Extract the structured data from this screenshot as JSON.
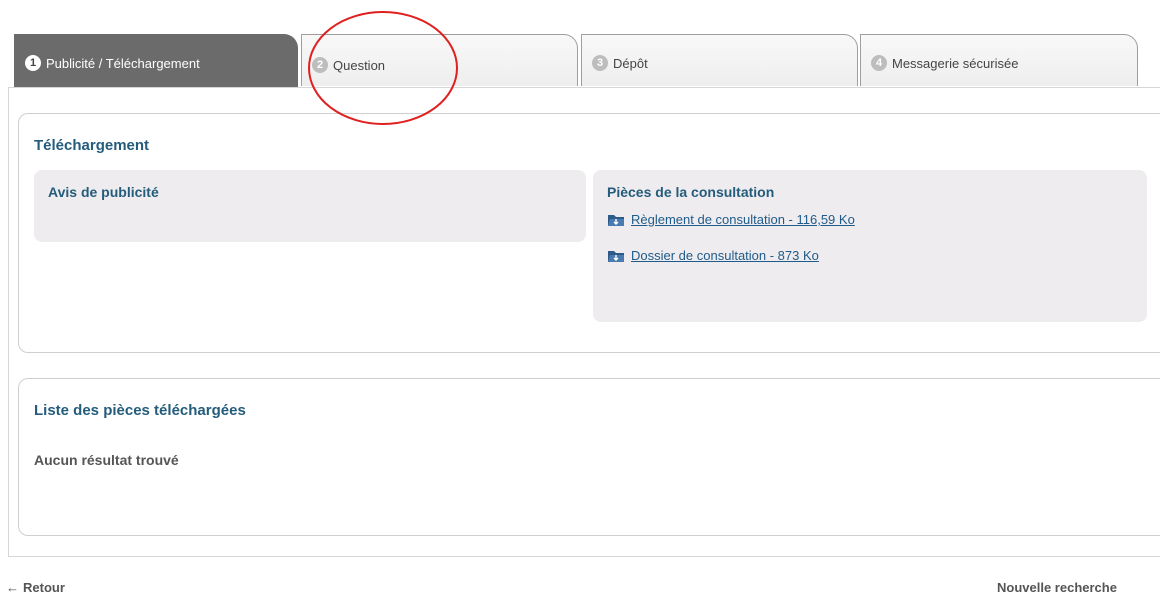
{
  "tabs": [
    {
      "number": "1",
      "label": "Publicité / Téléchargement",
      "active": true
    },
    {
      "number": "2",
      "label": "Question",
      "active": false
    },
    {
      "number": "3",
      "label": "Dépôt",
      "active": false
    },
    {
      "number": "4",
      "label": "Messagerie sécurisée",
      "active": false
    }
  ],
  "telechargement": {
    "title": "Téléchargement",
    "avis": {
      "title": "Avis de publicité"
    },
    "pieces": {
      "title": "Pièces de la consultation",
      "links": [
        {
          "label": "Règlement de consultation - 116,59 Ko",
          "icon": "folder-download-icon"
        },
        {
          "label": "Dossier de consultation - 873 Ko",
          "icon": "folder-download-icon"
        }
      ]
    }
  },
  "liste": {
    "title": "Liste des pièces téléchargées",
    "empty_message": "Aucun résultat trouvé"
  },
  "nav": {
    "back_label": "Retour",
    "new_search_label": "Nouvelle recherche"
  },
  "colors": {
    "active_tab": "#6b6b6b",
    "heading": "#245c7c",
    "link": "#1f5b8a",
    "annotation": "#e01f1f"
  }
}
